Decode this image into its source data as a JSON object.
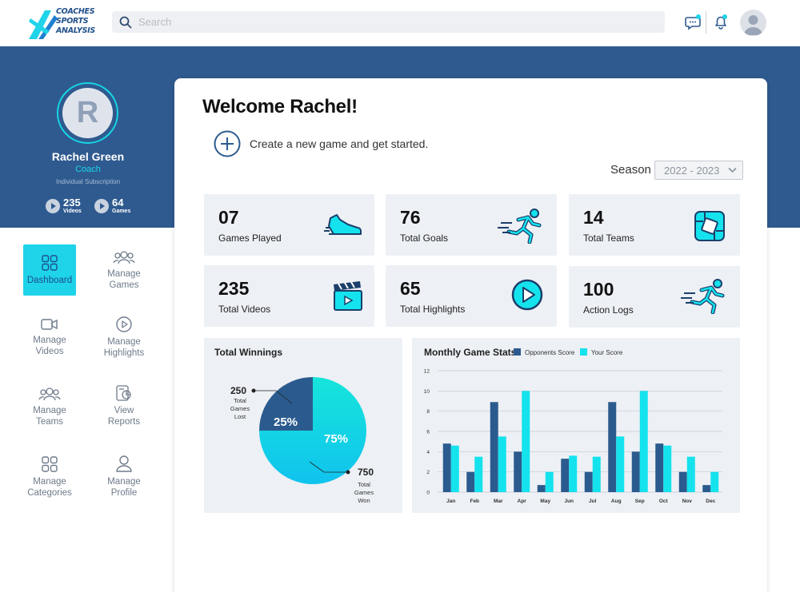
{
  "header": {
    "logo_lines": [
      "COACHES",
      "SPORTS",
      "ANALYSIS"
    ],
    "search_placeholder": "Search",
    "icons": [
      "chat-icon",
      "bell-icon",
      "user-avatar-icon"
    ]
  },
  "profile": {
    "initial": "R",
    "name": "Rachel Green",
    "role": "Coach",
    "subscription": "Individual Subscription",
    "videos_count": "235",
    "videos_label": "Videos",
    "games_count": "64",
    "games_label": "Games"
  },
  "nav": [
    {
      "label": "Dashboard",
      "icon": "grid-icon",
      "active": true
    },
    {
      "label": "Manage Games",
      "icon": "group-icon"
    },
    {
      "label": "Manage Videos",
      "icon": "video-camera-icon"
    },
    {
      "label": "Manage Highlights",
      "icon": "play-circle-icon"
    },
    {
      "label": "Manage Teams",
      "icon": "team-icon"
    },
    {
      "label": "View Reports",
      "icon": "report-icon"
    },
    {
      "label": "Manage Categories",
      "icon": "categories-icon"
    },
    {
      "label": "Manage Profile",
      "icon": "profile-icon"
    }
  ],
  "welcome": "Welcome Rachel!",
  "create_prompt": "Create a new game and get started.",
  "season": {
    "label": "Season",
    "selected": "2022 - 2023"
  },
  "cards": [
    {
      "value": "07",
      "label": "Games Played",
      "icon": "sneaker-icon"
    },
    {
      "value": "76",
      "label": "Total Goals",
      "icon": "runner-icon"
    },
    {
      "value": "14",
      "label": "Total Teams",
      "icon": "hands-together-icon"
    },
    {
      "value": "235",
      "label": "Total Videos",
      "icon": "clapperboard-icon"
    },
    {
      "value": "65",
      "label": "Total Highlights",
      "icon": "play-button-icon"
    },
    {
      "value": "100",
      "label": "Action Logs",
      "icon": "runner-icon"
    }
  ],
  "colors": {
    "brand_blue": "#2f5a8f",
    "accent_cyan": "#1fd3e8",
    "card_bg": "#edf0f5",
    "opponents": "#2b5b8e",
    "yours": "#14e3ee"
  },
  "chart_data": [
    {
      "type": "pie",
      "title": "Total Winnings",
      "slices": [
        {
          "label": "Total Games Lost",
          "count": "250",
          "value": 25,
          "display": "25%"
        },
        {
          "label": "Total Games Won",
          "count": "750",
          "value": 75,
          "display": "75%"
        }
      ]
    },
    {
      "type": "bar",
      "title": "Monthly Game Stats",
      "categories": [
        "Jan",
        "Feb",
        "Mar",
        "Apr",
        "May",
        "Jun",
        "Jul",
        "Aug",
        "Sep",
        "Oct",
        "Nov",
        "Dec"
      ],
      "series": [
        {
          "name": "Opponents Score",
          "values": [
            4.8,
            2,
            8.9,
            4,
            0.7,
            3.3,
            2,
            8.9,
            4,
            4.8,
            2,
            0.7
          ]
        },
        {
          "name": "Your Score",
          "values": [
            4.6,
            3.5,
            5.5,
            10,
            2,
            3.6,
            3.5,
            5.5,
            10,
            4.6,
            3.5,
            2
          ]
        }
      ],
      "ylim": [
        0,
        12
      ],
      "yticks": [
        "0",
        "2",
        "4",
        "6",
        "8",
        "10",
        "12"
      ],
      "grid": true,
      "legend": "top"
    }
  ]
}
